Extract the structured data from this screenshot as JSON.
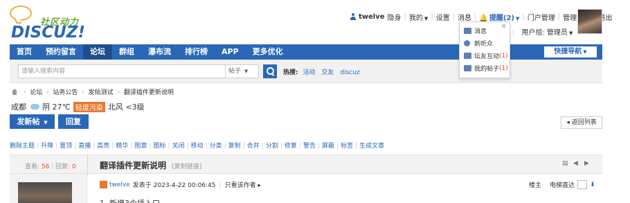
{
  "logo": {
    "tagline": "社区动力",
    "brand": "DISCUZ!"
  },
  "userbar": {
    "username": "twelve",
    "invisible": "隐身",
    "my": "我的",
    "settings": "设置",
    "messages": "消息",
    "remind": "提醒(2)",
    "portal_manage": "门户管理",
    "admin_center": "管理中心",
    "logout": "退出",
    "user_group": "用户组: 管理员"
  },
  "remind_menu": {
    "items": [
      {
        "label": "消息",
        "count": ""
      },
      {
        "label": "新听众",
        "count": ""
      },
      {
        "label": "坛友互动",
        "count": "(1)"
      },
      {
        "label": "我的帖子",
        "count": "(1)"
      }
    ]
  },
  "nav": {
    "items": [
      "首页",
      "预约留言",
      "论坛",
      "群组",
      "瀑布流",
      "排行榜",
      "APP",
      "更多优化"
    ],
    "active_index": 2,
    "quick_nav": "快捷导航"
  },
  "search": {
    "placeholder": "请输入搜索内容",
    "type": "帖子",
    "hot_label": "热搜:",
    "hot_terms": [
      "活动",
      "交友",
      "discuz"
    ]
  },
  "breadcrumb": [
    "论坛",
    "站务公告",
    "发帖测试",
    "翻译插件更新说明"
  ],
  "weather": {
    "city": "成都",
    "condition": "阴 27℃",
    "air_quality": "轻度污染",
    "wind": "北风 <3级"
  },
  "actions": {
    "new_post": "发新帖",
    "reply": "回复",
    "back": "返回列表"
  },
  "mod_actions": [
    "删除主题",
    "升降",
    "置顶",
    "直播",
    "高亮",
    "精华",
    "图章",
    "图标",
    "关闭",
    "移动",
    "分类",
    "复制",
    "合并",
    "分割",
    "修复",
    "警告",
    "屏蔽",
    "标签",
    "生成文章"
  ],
  "thread": {
    "views_label": "查看:",
    "views": "56",
    "replies_label": "回复:",
    "replies": "0",
    "title": "翻译插件更新说明",
    "copy_link": "[复制链接]"
  },
  "post": {
    "author": "twelve",
    "posted": "发表于 2023-4-22 00:06:45",
    "only_author": "只看该作者",
    "floor": "楼主",
    "elevator": "电梯直达",
    "text": "1. 新增3个插入口"
  }
}
